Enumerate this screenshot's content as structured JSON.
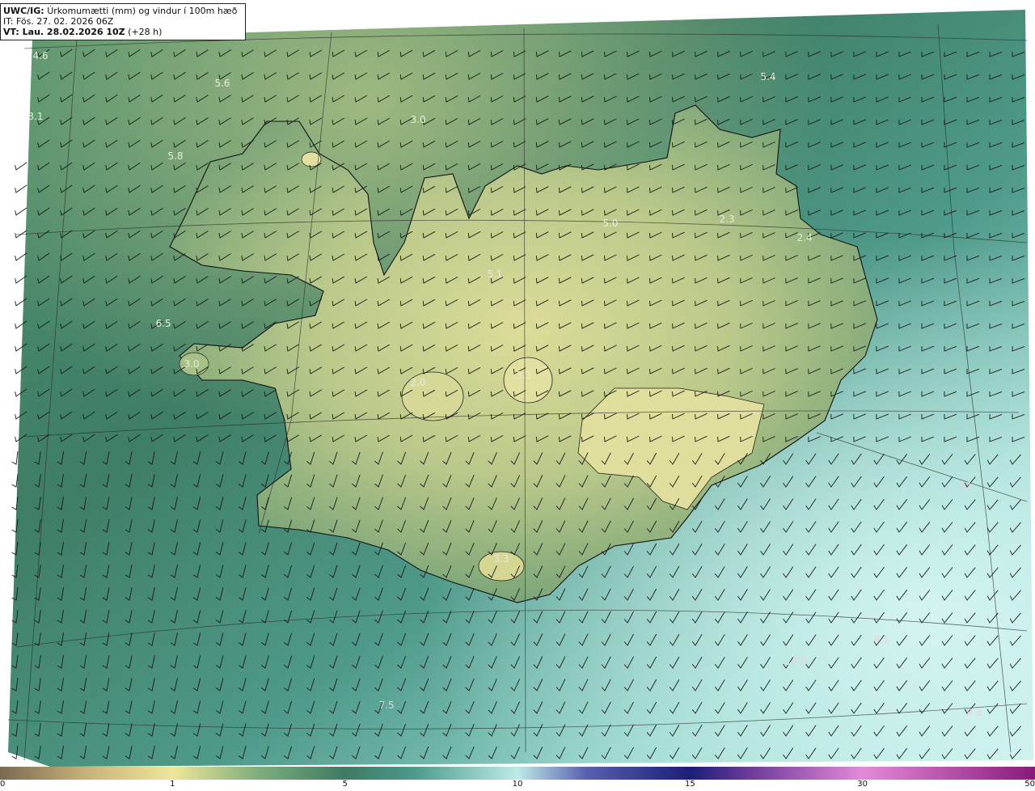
{
  "header": {
    "model": "UWC/IG:",
    "title": "Úrkomumætti (mm) og vindur í 100m hæð",
    "init_time": "IT: Fös. 27. 02. 2026 06Z",
    "valid_prefix": "VT: Lau. 28.02.2026 10Z",
    "valid_suffix": "(+28 h)"
  },
  "value_labels": [
    {
      "text": "4.6",
      "dim": false
    },
    {
      "text": "5.6",
      "dim": false
    },
    {
      "text": "5.4",
      "dim": false
    },
    {
      "text": "3.1",
      "dim": false
    },
    {
      "text": "3.0",
      "dim": false
    },
    {
      "text": "5.8",
      "dim": false
    },
    {
      "text": "5.0",
      "dim": false
    },
    {
      "text": "2.3",
      "dim": false
    },
    {
      "text": "2.4",
      "dim": false
    },
    {
      "text": "5.1",
      "dim": false
    },
    {
      "text": "6.5",
      "dim": false
    },
    {
      "text": "3.0",
      "dim": false
    },
    {
      "text": "2.0",
      "dim": false
    },
    {
      "text": "3.3",
      "dim": false
    },
    {
      "text": "3.3",
      "dim": false
    },
    {
      "text": "11",
      "dim": true
    },
    {
      "text": "9.1",
      "dim": true
    },
    {
      "text": "10.0",
      "dim": true
    },
    {
      "text": "7.5",
      "dim": true
    },
    {
      "text": "9.3",
      "dim": true
    }
  ],
  "colorbar": {
    "ticks": [
      "0",
      "1",
      "5",
      "10",
      "15",
      "30",
      "50"
    ],
    "stops": [
      {
        "v": 0,
        "c": "#7a6a52"
      },
      {
        "v": 0.5,
        "c": "#c9b27a"
      },
      {
        "v": 1,
        "c": "#efe79a"
      },
      {
        "v": 2,
        "c": "#b6c98a"
      },
      {
        "v": 3,
        "c": "#7fae7e"
      },
      {
        "v": 5,
        "c": "#3f7a64"
      },
      {
        "v": 7,
        "c": "#4f9a8e"
      },
      {
        "v": 10,
        "c": "#bdebe6"
      },
      {
        "v": 12,
        "c": "#5a5fb0"
      },
      {
        "v": 15,
        "c": "#1c1e7a"
      },
      {
        "v": 20,
        "c": "#6a3a9a"
      },
      {
        "v": 30,
        "c": "#e48ad8"
      },
      {
        "v": 50,
        "c": "#8a1a7a"
      }
    ]
  },
  "colors": {
    "ocean_dark": "#2f6e5a",
    "ocean_light": "#b5e5e0",
    "land_high": "#d9dc96",
    "land_mid": "#8fb47c",
    "coast": "#111111",
    "grid": "#333333",
    "barb": "#1a1a1a"
  }
}
